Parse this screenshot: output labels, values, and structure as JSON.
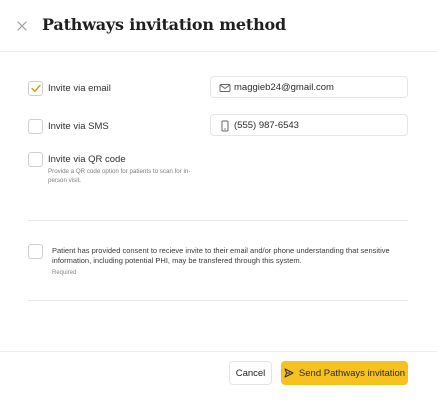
{
  "modal": {
    "title": "Pathways invitation method"
  },
  "options": [
    {
      "label": "Invite via email",
      "checked": true
    },
    {
      "label": "Invite via SMS",
      "checked": false
    },
    {
      "label": "Invite via QR code",
      "checked": false,
      "help": "Provide a QR code option for patients to scan for in-person visit."
    }
  ],
  "fields": {
    "email": {
      "value": "maggieb24@gmail.com",
      "icon": "mail-icon"
    },
    "phone": {
      "value": "(555) 987-6543",
      "icon": "phone-icon"
    }
  },
  "consent": {
    "checked": false,
    "text": "Patient has provided consent to recieve invite to their email and/or phone understanding that sensitive information, including potential PHI, may be transfered through this system.",
    "required_label": "Required"
  },
  "footer": {
    "cancel_label": "Cancel",
    "send_label": "Send Pathways invitation"
  },
  "colors": {
    "accent": "#f7c220",
    "check_mark": "#d99a00"
  }
}
